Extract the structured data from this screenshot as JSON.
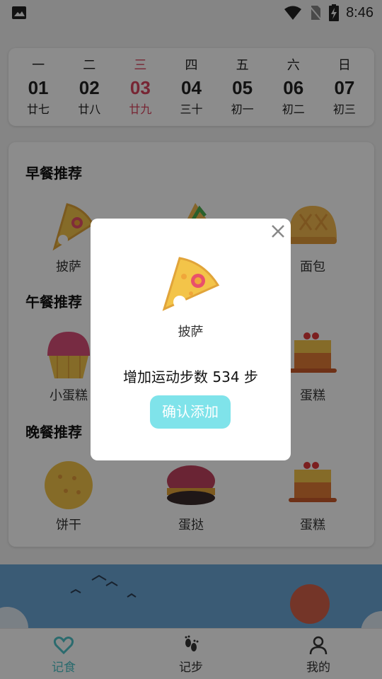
{
  "status_bar": {
    "time": "8:46"
  },
  "calendar": {
    "days": [
      {
        "weekday": "一",
        "date": "01",
        "lunar": "廿七"
      },
      {
        "weekday": "二",
        "date": "02",
        "lunar": "廿八"
      },
      {
        "weekday": "三",
        "date": "03",
        "lunar": "廿九",
        "active": true
      },
      {
        "weekday": "四",
        "date": "04",
        "lunar": "三十"
      },
      {
        "weekday": "五",
        "date": "05",
        "lunar": "初一"
      },
      {
        "weekday": "六",
        "date": "06",
        "lunar": "初二"
      },
      {
        "weekday": "日",
        "date": "07",
        "lunar": "初三"
      }
    ]
  },
  "meals": {
    "breakfast": {
      "title": "早餐推荐",
      "items": [
        "披萨",
        "",
        "面包"
      ]
    },
    "lunch": {
      "title": "午餐推荐",
      "items": [
        "小蛋糕",
        "",
        "蛋糕"
      ]
    },
    "dinner": {
      "title": "晚餐推荐",
      "items": [
        "饼干",
        "蛋挞",
        "蛋糕"
      ]
    }
  },
  "tabs": [
    {
      "label": "记食",
      "icon": "heart-icon",
      "active": true
    },
    {
      "label": "记步",
      "icon": "footprints-icon"
    },
    {
      "label": "我的",
      "icon": "person-icon"
    }
  ],
  "dialog": {
    "food_name": "披萨",
    "message": "增加运动步数 534 步",
    "confirm_label": "确认添加",
    "close_icon": "close-icon"
  },
  "colors": {
    "accent": "#4fc3c8",
    "confirm_button": "#7fe3ea",
    "active_date": "#d9455f"
  }
}
